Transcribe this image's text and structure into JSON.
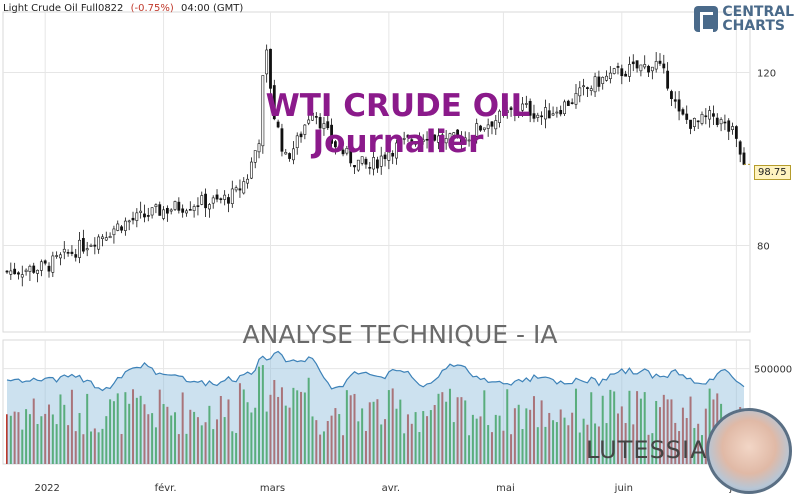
{
  "header": {
    "instrument": "Light Crude Oil Full0822",
    "change": "(-0.75%)",
    "time": "04:00 (GMT)"
  },
  "brand": {
    "line1": "CENTRAL",
    "line2": "CHARTS"
  },
  "watermark": {
    "title": "WTI CRUDE OIL",
    "subtitle": "Journalier",
    "analysis": "ANALYSE TECHNIQUE - IA"
  },
  "footer_brand": "LUTESSIA",
  "colors": {
    "up": "#2ea02e",
    "down": "#c0392b",
    "candle_up": "#ffffff",
    "candle_down": "#111111",
    "volume_line": "#3d82b8",
    "volume_fill": "#8fbcdc",
    "watermark": "#8b1a8b",
    "grid": "#e6e6e6"
  },
  "chart_data": {
    "type": "candlestick",
    "timeframe": "Journalier",
    "price_axis": {
      "ylim": [
        60,
        134
      ],
      "ticks": [
        80,
        120
      ],
      "current_price": "98.75"
    },
    "volume_axis": {
      "ylim": [
        0,
        650000
      ],
      "ticks": [
        {
          "value": 500000,
          "label": "500000"
        }
      ]
    },
    "x_ticks": [
      {
        "day": 10,
        "label": "2022"
      },
      {
        "day": 41,
        "label": "févr."
      },
      {
        "day": 69,
        "label": "mars"
      },
      {
        "day": 100,
        "label": "avr."
      },
      {
        "day": 130,
        "label": "mai"
      },
      {
        "day": 161,
        "label": "juin"
      },
      {
        "day": 191,
        "label": "juil."
      }
    ],
    "price_path": [
      {
        "day": 0,
        "close": 74
      },
      {
        "day": 10,
        "close": 75
      },
      {
        "day": 20,
        "close": 80
      },
      {
        "day": 30,
        "close": 85
      },
      {
        "day": 40,
        "close": 88
      },
      {
        "day": 50,
        "close": 90
      },
      {
        "day": 55,
        "close": 90
      },
      {
        "day": 60,
        "close": 92
      },
      {
        "day": 63,
        "close": 96
      },
      {
        "day": 66,
        "close": 105
      },
      {
        "day": 67,
        "close": 118
      },
      {
        "day": 68,
        "close": 124
      },
      {
        "day": 70,
        "close": 110
      },
      {
        "day": 73,
        "close": 100
      },
      {
        "day": 76,
        "close": 104
      },
      {
        "day": 80,
        "close": 112
      },
      {
        "day": 85,
        "close": 104
      },
      {
        "day": 90,
        "close": 100
      },
      {
        "day": 95,
        "close": 98
      },
      {
        "day": 100,
        "close": 102
      },
      {
        "day": 105,
        "close": 104
      },
      {
        "day": 110,
        "close": 106
      },
      {
        "day": 115,
        "close": 104
      },
      {
        "day": 120,
        "close": 105
      },
      {
        "day": 125,
        "close": 108
      },
      {
        "day": 130,
        "close": 110
      },
      {
        "day": 135,
        "close": 112
      },
      {
        "day": 140,
        "close": 110
      },
      {
        "day": 145,
        "close": 112
      },
      {
        "day": 150,
        "close": 115
      },
      {
        "day": 155,
        "close": 118
      },
      {
        "day": 160,
        "close": 120
      },
      {
        "day": 165,
        "close": 121
      },
      {
        "day": 170,
        "close": 122
      },
      {
        "day": 173,
        "close": 118
      },
      {
        "day": 176,
        "close": 110
      },
      {
        "day": 180,
        "close": 108
      },
      {
        "day": 185,
        "close": 110
      },
      {
        "day": 190,
        "close": 106
      },
      {
        "day": 193,
        "close": 98.75
      }
    ]
  }
}
